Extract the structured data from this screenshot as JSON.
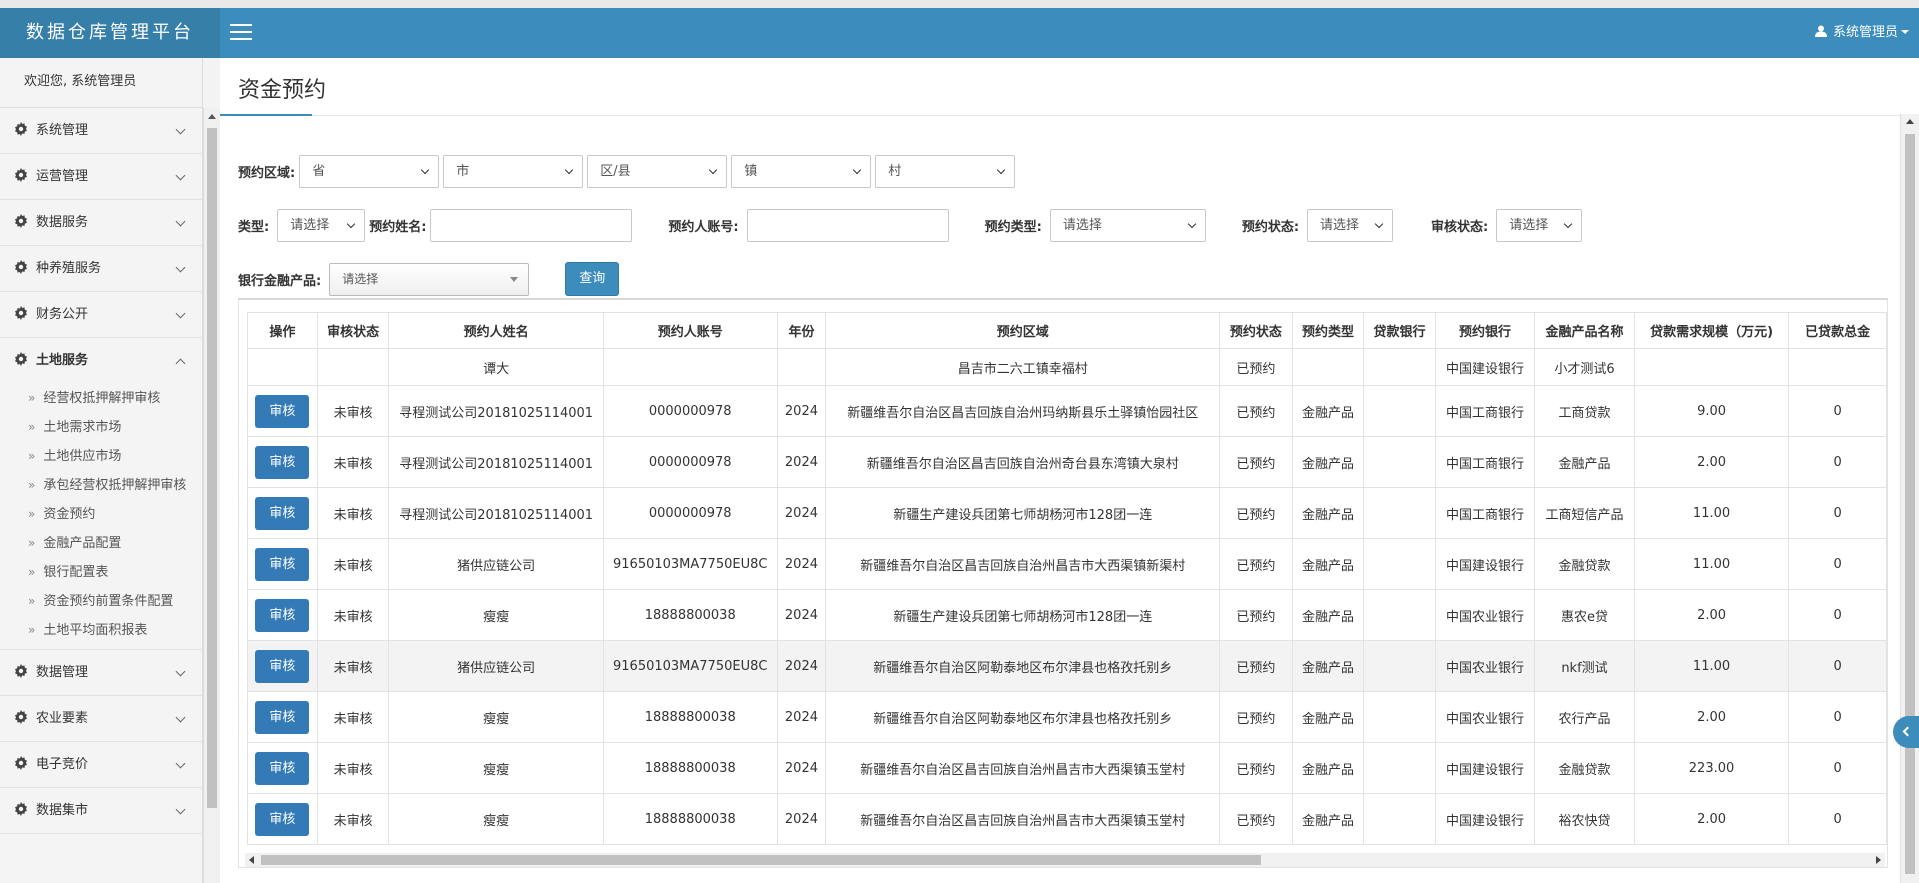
{
  "app": {
    "title": "数据仓库管理平台"
  },
  "header": {
    "user": "系统管理员"
  },
  "sidebar": {
    "welcome": "欢迎您, 系统管理员",
    "items_top": [
      {
        "label": "系统管理"
      },
      {
        "label": "运营管理"
      },
      {
        "label": "数据服务"
      },
      {
        "label": "种养殖服务"
      },
      {
        "label": "财务公开"
      }
    ],
    "open_item": {
      "label": "土地服务"
    },
    "sub_items": [
      "经营权抵押解押审核",
      "土地需求市场",
      "土地供应市场",
      "承包经营权抵押解押审核",
      "资金预约",
      "金融产品配置",
      "银行配置表",
      "资金预约前置条件配置",
      "土地平均面积报表"
    ],
    "items_bottom": [
      {
        "label": "数据管理"
      },
      {
        "label": "农业要素"
      },
      {
        "label": "电子竞价"
      },
      {
        "label": "数据集市"
      }
    ]
  },
  "page": {
    "title": "资金预约"
  },
  "filters": {
    "region_label": "预约区域:",
    "province": "省",
    "city": "市",
    "district": "区/县",
    "town": "镇",
    "village": "村",
    "type_label": "类型:",
    "type_value": "请选择",
    "name_label": "预约姓名:",
    "account_label": "预约人账号:",
    "booking_type_label": "预约类型:",
    "booking_type_value": "请选择",
    "booking_status_label": "预约状态:",
    "booking_status_value": "请选择",
    "audit_status_label": "审核状态:",
    "audit_status_value": "请选择",
    "product_label": "银行金融产品:",
    "product_value": "请选择",
    "query_button": "查询"
  },
  "table": {
    "headers": [
      "操作",
      "审核状态",
      "预约人姓名",
      "预约人账号",
      "年份",
      "预约区域",
      "预约状态",
      "预约类型",
      "贷款银行",
      "预约银行",
      "金融产品名称",
      "贷款需求规模（万元)",
      "已贷款总金"
    ],
    "first_row": [
      "",
      "",
      "谭大",
      "",
      "",
      "昌吉市二六工镇幸福村",
      "已预约",
      "",
      "",
      "中国建设银行",
      "小才测试6",
      "",
      ""
    ],
    "rows": [
      [
        "审核",
        "未审核",
        "寻程测试公司20181025114001",
        "0000000978",
        "2024",
        "新疆维吾尔自治区昌吉回族自治州玛纳斯县乐土驿镇怡园社区",
        "已预约",
        "金融产品",
        "",
        "中国工商银行",
        "工商贷款",
        "9.00",
        "0"
      ],
      [
        "审核",
        "未审核",
        "寻程测试公司20181025114001",
        "0000000978",
        "2024",
        "新疆维吾尔自治区昌吉回族自治州奇台县东湾镇大泉村",
        "已预约",
        "金融产品",
        "",
        "中国工商银行",
        "金融产品",
        "2.00",
        "0"
      ],
      [
        "审核",
        "未审核",
        "寻程测试公司20181025114001",
        "0000000978",
        "2024",
        "新疆生产建设兵团第七师胡杨河市128团一连",
        "已预约",
        "金融产品",
        "",
        "中国工商银行",
        "工商短信产品",
        "11.00",
        "0"
      ],
      [
        "审核",
        "未审核",
        "猪供应链公司",
        "91650103MA7750EU8C",
        "2024",
        "新疆维吾尔自治区昌吉回族自治州昌吉市大西渠镇新渠村",
        "已预约",
        "金融产品",
        "",
        "中国建设银行",
        "金融贷款",
        "11.00",
        "0"
      ],
      [
        "审核",
        "未审核",
        "瘦瘦",
        "18888800038",
        "2024",
        "新疆生产建设兵团第七师胡杨河市128团一连",
        "已预约",
        "金融产品",
        "",
        "中国农业银行",
        "惠农e贷",
        "2.00",
        "0"
      ],
      [
        "审核",
        "未审核",
        "猪供应链公司",
        "91650103MA7750EU8C",
        "2024",
        "新疆维吾尔自治区阿勒泰地区布尔津县也格孜托别乡",
        "已预约",
        "金融产品",
        "",
        "中国农业银行",
        "nkf测试",
        "11.00",
        "0"
      ],
      [
        "审核",
        "未审核",
        "瘦瘦",
        "18888800038",
        "2024",
        "新疆维吾尔自治区阿勒泰地区布尔津县也格孜托别乡",
        "已预约",
        "金融产品",
        "",
        "中国农业银行",
        "农行产品",
        "2.00",
        "0"
      ],
      [
        "审核",
        "未审核",
        "瘦瘦",
        "18888800038",
        "2024",
        "新疆维吾尔自治区昌吉回族自治州昌吉市大西渠镇玉堂村",
        "已预约",
        "金融产品",
        "",
        "中国建设银行",
        "金融贷款",
        "223.00",
        "0"
      ],
      [
        "审核",
        "未审核",
        "瘦瘦",
        "18888800038",
        "2024",
        "新疆维吾尔自治区昌吉回族自治州昌吉市大西渠镇玉堂村",
        "已预约",
        "金融产品",
        "",
        "中国建设银行",
        "裕农快贷",
        "2.00",
        "0"
      ]
    ]
  },
  "colors": {
    "primary": "#3c8dbc",
    "brand_bg": "#367fa9",
    "audit_button": "#337ab7"
  },
  "icons": [
    "menu-icon",
    "user-icon",
    "gear-icon",
    "chevron-down-icon",
    "chevron-up-icon",
    "chevron-left-icon"
  ]
}
